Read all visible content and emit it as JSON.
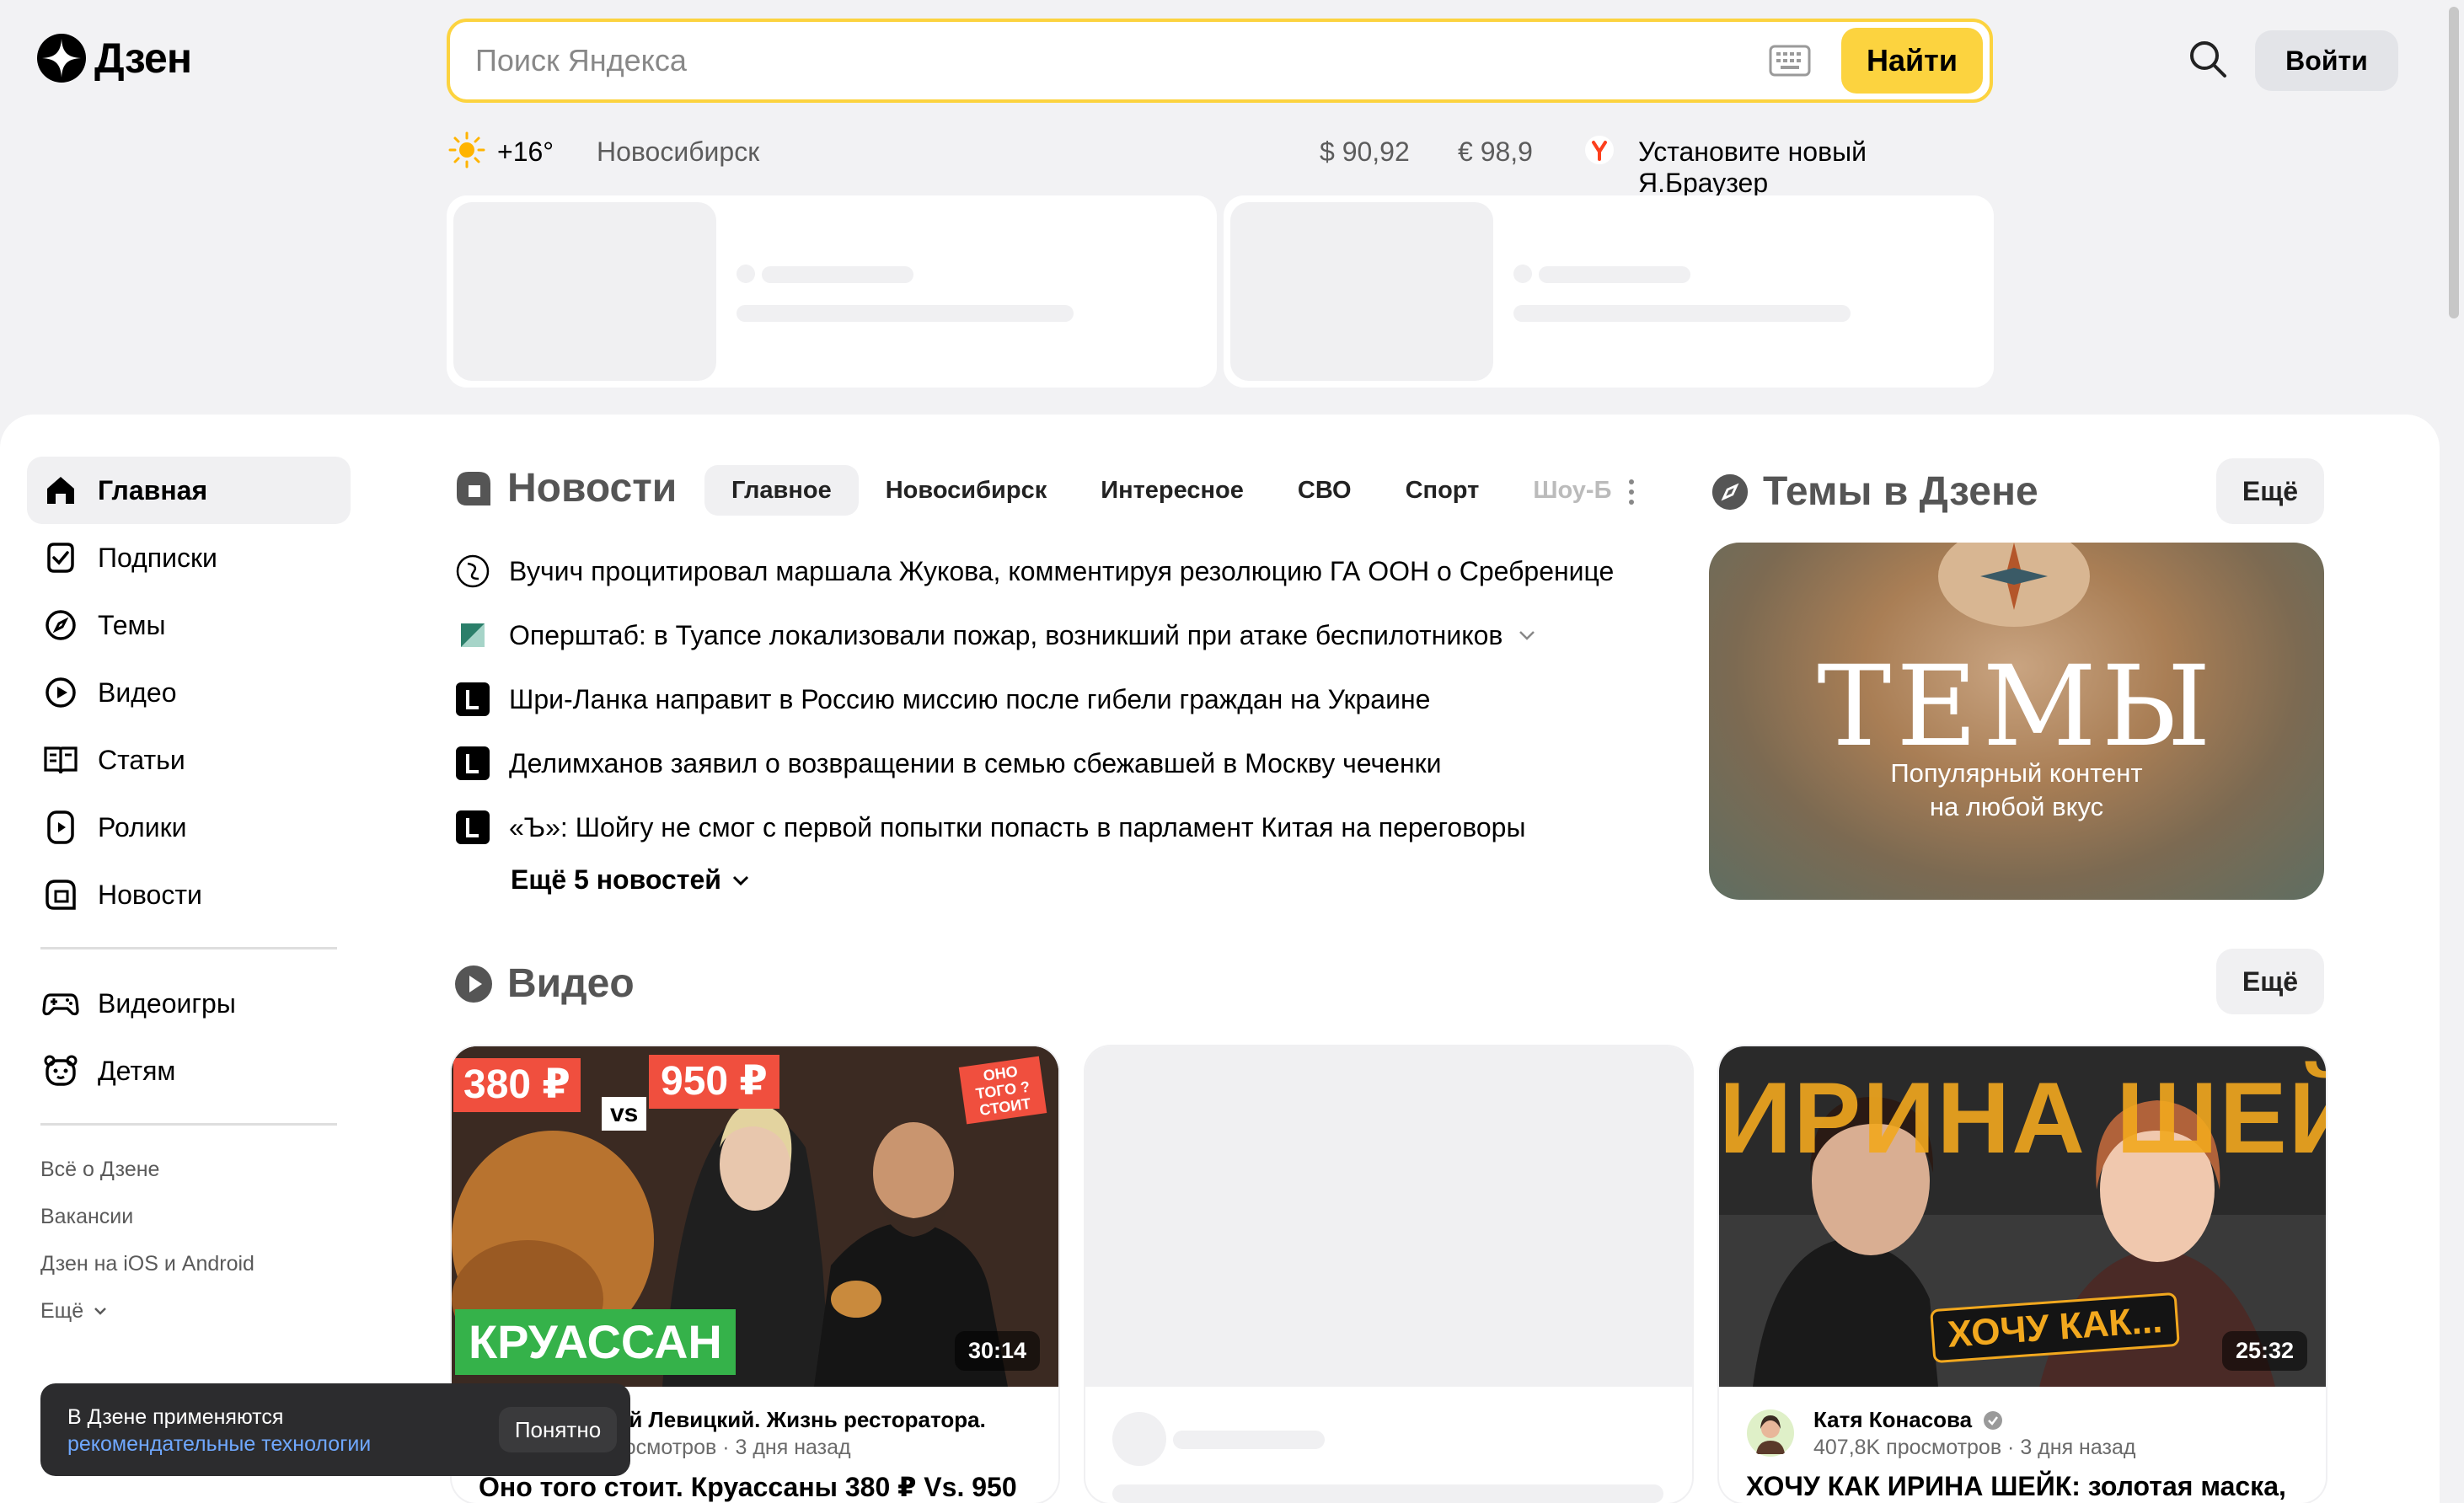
{
  "brand": {
    "name": "Дзен"
  },
  "search": {
    "placeholder": "Поиск Яндекса",
    "button": "Найти"
  },
  "header": {
    "login": "Войти"
  },
  "infobar": {
    "temperature": "+16°",
    "city": "Новосибирск",
    "usd": "$ 90,92",
    "eur": "€ 98,9",
    "browser_promo": "Установите новый Я.Браузер"
  },
  "sidebar": {
    "items": [
      {
        "label": "Главная",
        "icon": "home-icon",
        "active": true
      },
      {
        "label": "Подписки",
        "icon": "subscriptions-icon"
      },
      {
        "label": "Темы",
        "icon": "compass-icon"
      },
      {
        "label": "Видео",
        "icon": "video-icon"
      },
      {
        "label": "Статьи",
        "icon": "articles-icon"
      },
      {
        "label": "Ролики",
        "icon": "shorts-icon"
      },
      {
        "label": "Новости",
        "icon": "news-icon"
      }
    ],
    "extra": [
      {
        "label": "Видеоигры",
        "icon": "gamepad-icon"
      },
      {
        "label": "Детям",
        "icon": "kids-icon"
      }
    ],
    "footer": [
      "Всё о Дзене",
      "Вакансии",
      "Дзен на iOS и Android",
      "Ещё"
    ]
  },
  "news": {
    "title": "Новости",
    "tabs": [
      "Главное",
      "Новосибирск",
      "Интересное",
      "СВО",
      "Спорт",
      "Шоу-Б"
    ],
    "items": [
      "Вучич процитировал маршала Жукова, комментируя резолюцию ГА ООН о Сребренице",
      "Оперштаб: в Туапсе локализовали пожар, возникший при атаке беспилотников",
      "Шри-Ланка направит в Россию миссию после гибели граждан на Украине",
      "Делимханов заявил о возвращении в семью сбежавшей в Москву чеченки",
      "«Ъ»: Шойгу не смог с первой попытки попасть в парламент Китая на переговоры"
    ],
    "more": "Ещё 5 новостей"
  },
  "themes": {
    "title": "Темы в Дзене",
    "more": "Ещё",
    "banner_title": "ТЕМЫ",
    "banner_sub1": "Популярный контент",
    "banner_sub2": "на любой вкус"
  },
  "video": {
    "title": "Видео",
    "more": "Ещё",
    "cards": [
      {
        "duration": "30:14",
        "author": "Дмитрий Левицкий. Жизнь ресторатора.",
        "stats": "407K просмотров · 3 дня назад",
        "title": "Оно того стоит. Круассаны 380 ₽ Vs. 950",
        "thumb_text_price1": "380 ₽",
        "thumb_text_price2": "950 ₽",
        "thumb_text_vs": "vs",
        "thumb_text_word": "КРУАССАН",
        "thumb_badge": "ОНО ТОГО ? СТОИТ"
      },
      {
        "duration": "25:32",
        "author": "Катя Конасова",
        "stats": "407,8K просмотров · 3 дня назад",
        "title": "ХОЧУ КАК ИРИНА ШЕЙК: золотая маска,",
        "thumb_text_top": "ИРИНА ШЕЙК",
        "thumb_text_badge": "ХОЧУ КАК..."
      }
    ]
  },
  "toast": {
    "line1": "В Дзене применяются",
    "link": "рекомендательные технологии",
    "ok": "Понятно"
  },
  "colors": {
    "accent": "#fcd33f",
    "link": "#6fa8ff",
    "toast_bg": "#2c2c2e"
  }
}
